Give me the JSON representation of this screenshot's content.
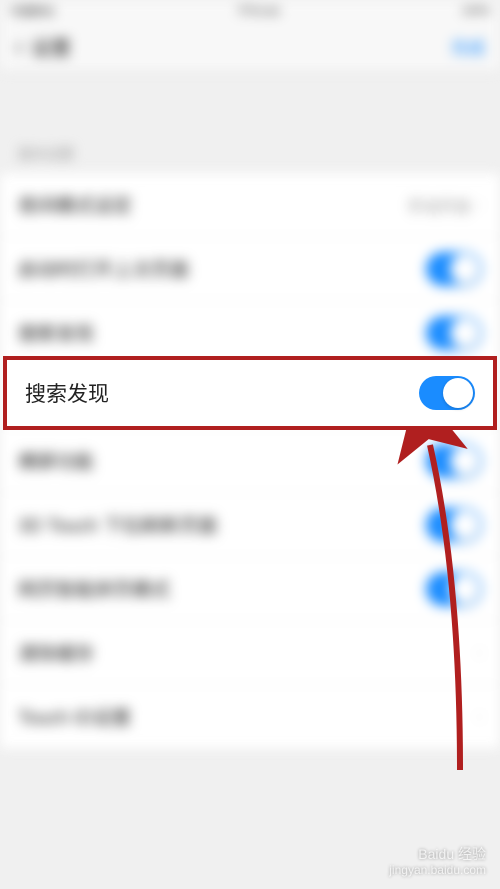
{
  "status_bar": {
    "carrier": "中国移动",
    "time": "下午3:00",
    "battery": "100%"
  },
  "nav": {
    "back_label": "设置",
    "action": "完成"
  },
  "section": {
    "header": "基本设置"
  },
  "rows": {
    "r0": {
      "label": "夜间模式设定",
      "value": "手动开启"
    },
    "r1": {
      "label": "启动时打开上次页面"
    },
    "r2": {
      "label": "搜索发现"
    },
    "r3": {
      "label": "小窗口视频"
    },
    "r4": {
      "label": "横屏功能"
    },
    "r5": {
      "label": "3D Touch 下拉刷新页面"
    },
    "r6": {
      "label": "网页智能拼页模式"
    },
    "r7": {
      "label": "清除缓存"
    },
    "r8": {
      "label": "Touch ID设置"
    }
  },
  "highlight": {
    "label": "搜索发现"
  },
  "watermark": {
    "brand": "Baidu 经验",
    "url": "jingyan.baidu.com"
  },
  "colors": {
    "accent": "#1a8cff",
    "highlight_border": "#b01f1f"
  }
}
